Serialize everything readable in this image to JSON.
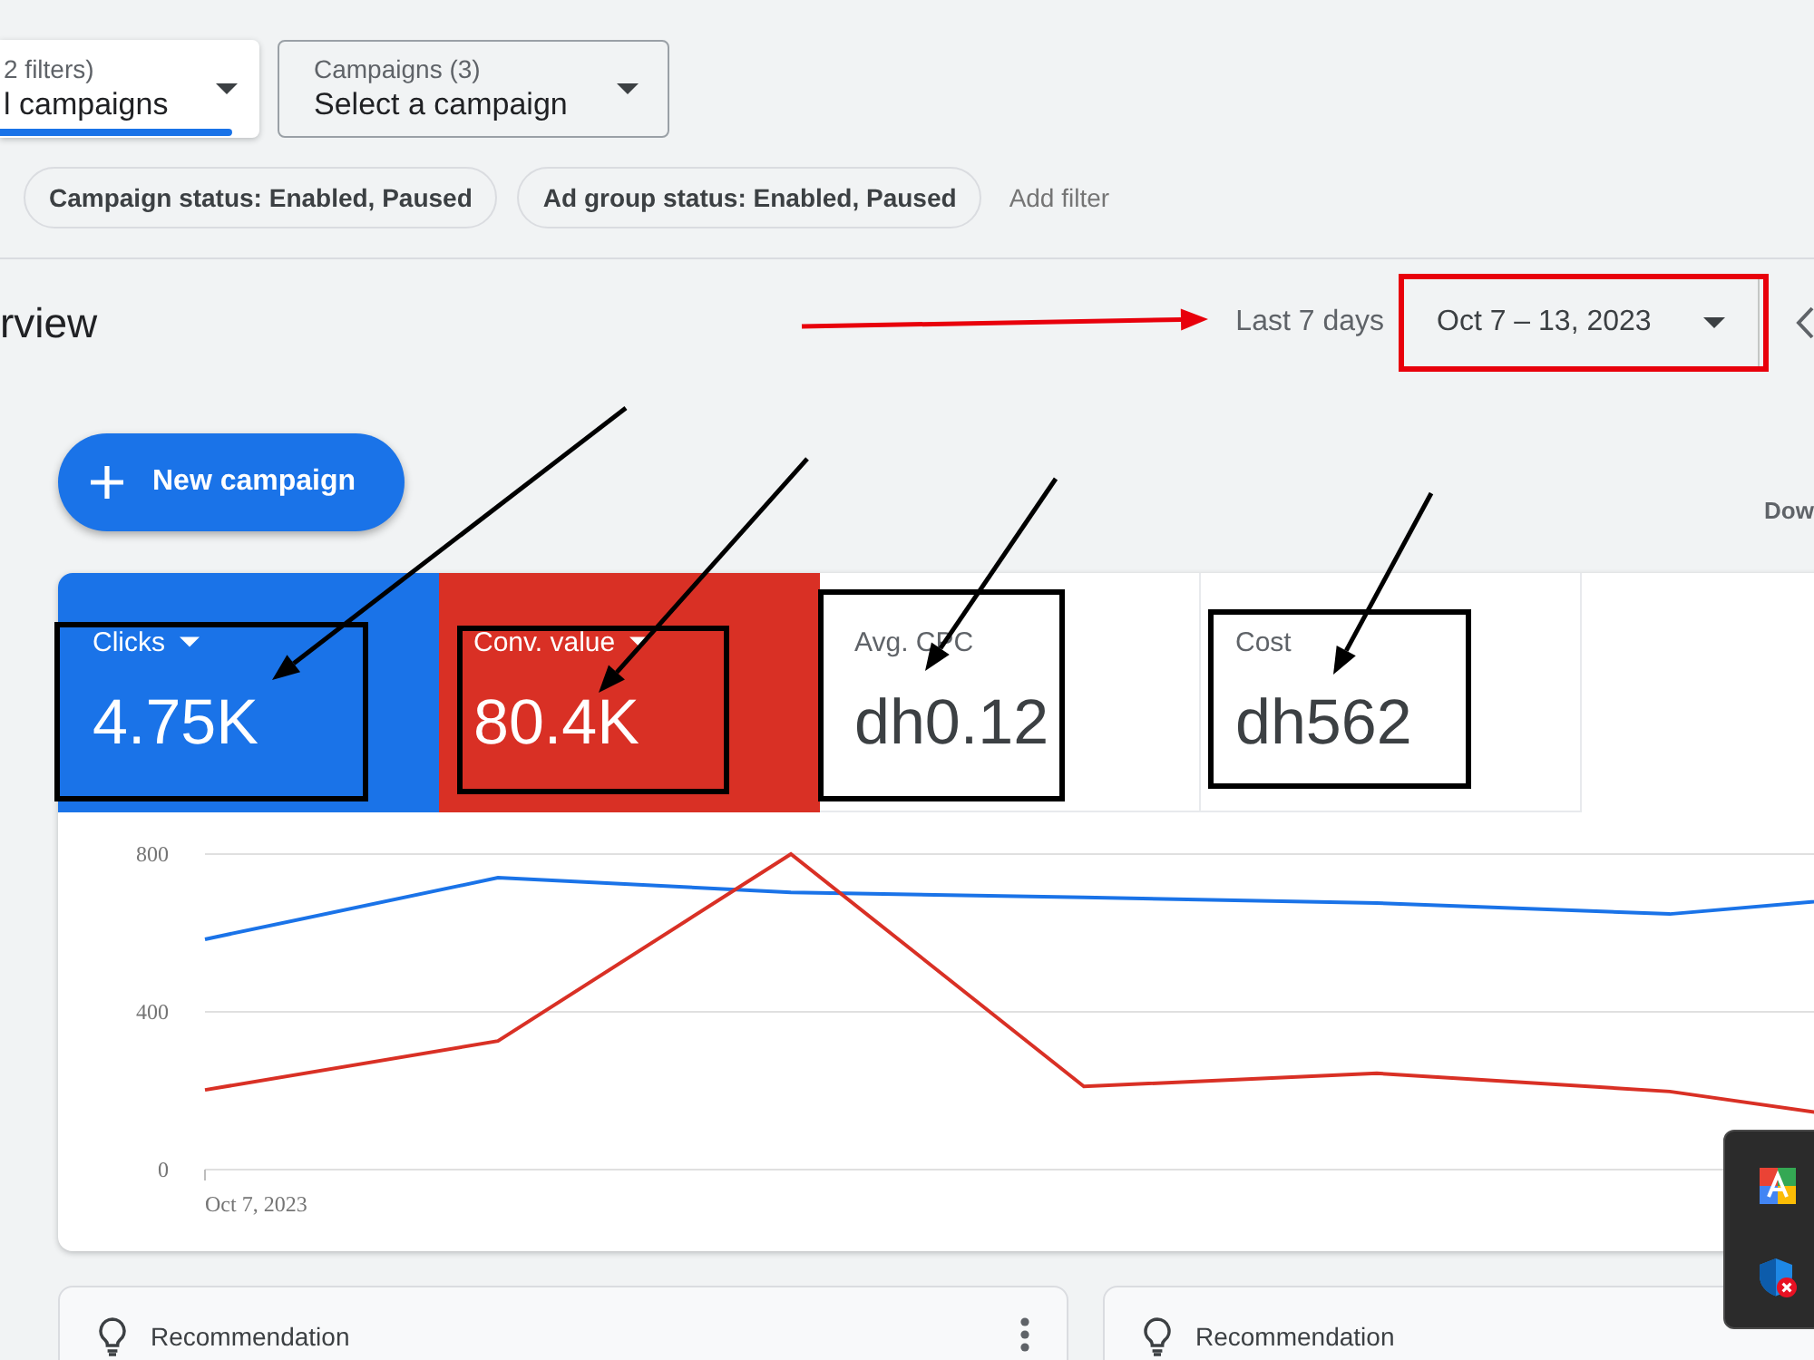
{
  "filters": {
    "dropdowns": [
      {
        "label": "2 filters)",
        "value": "l campaigns",
        "selected": true
      },
      {
        "label": "Campaigns (3)",
        "value": "Select a campaign",
        "selected": false
      }
    ],
    "chips": [
      "Campaign status: Enabled, Paused",
      "Ad group status: Enabled, Paused"
    ],
    "add_filter": "Add filter"
  },
  "header": {
    "title": "rview",
    "range_label": "Last 7 days",
    "date_range": {
      "value": "Oct 7 – 13, 2023",
      "marked": true
    }
  },
  "toolbar": {
    "new_campaign": "New campaign",
    "download": "Dow"
  },
  "metrics": [
    {
      "label": "Clicks",
      "value": "4.75K",
      "selected": true,
      "color": "#1a73e8",
      "marked": true
    },
    {
      "label": "Conv. value",
      "value": "80.4K",
      "selected": true,
      "color": "#d93025",
      "marked": true
    },
    {
      "label": "Avg. CPC",
      "value": "dh0.12",
      "selected": false,
      "marked": true
    },
    {
      "label": "Cost",
      "value": "dh562",
      "selected": false,
      "marked": true
    }
  ],
  "chart_data": [
    {
      "type": "line",
      "annotations": [
        "Oct 7, 2023"
      ],
      "ylim": [
        0,
        800
      ],
      "yticks": [
        0,
        400,
        800
      ],
      "grid": true,
      "series": [
        {
          "color": "#1a73e8",
          "values": [
            584,
            740,
            703,
            690,
            676,
            648,
            712
          ]
        },
        {
          "color": "#d93025",
          "values": [
            202,
            326,
            800,
            211,
            244,
            198,
            92
          ]
        }
      ]
    }
  ],
  "recommendations": [
    {
      "title": "Recommendation",
      "menu": true
    },
    {
      "title": "Recommendation",
      "menu": false
    }
  ]
}
